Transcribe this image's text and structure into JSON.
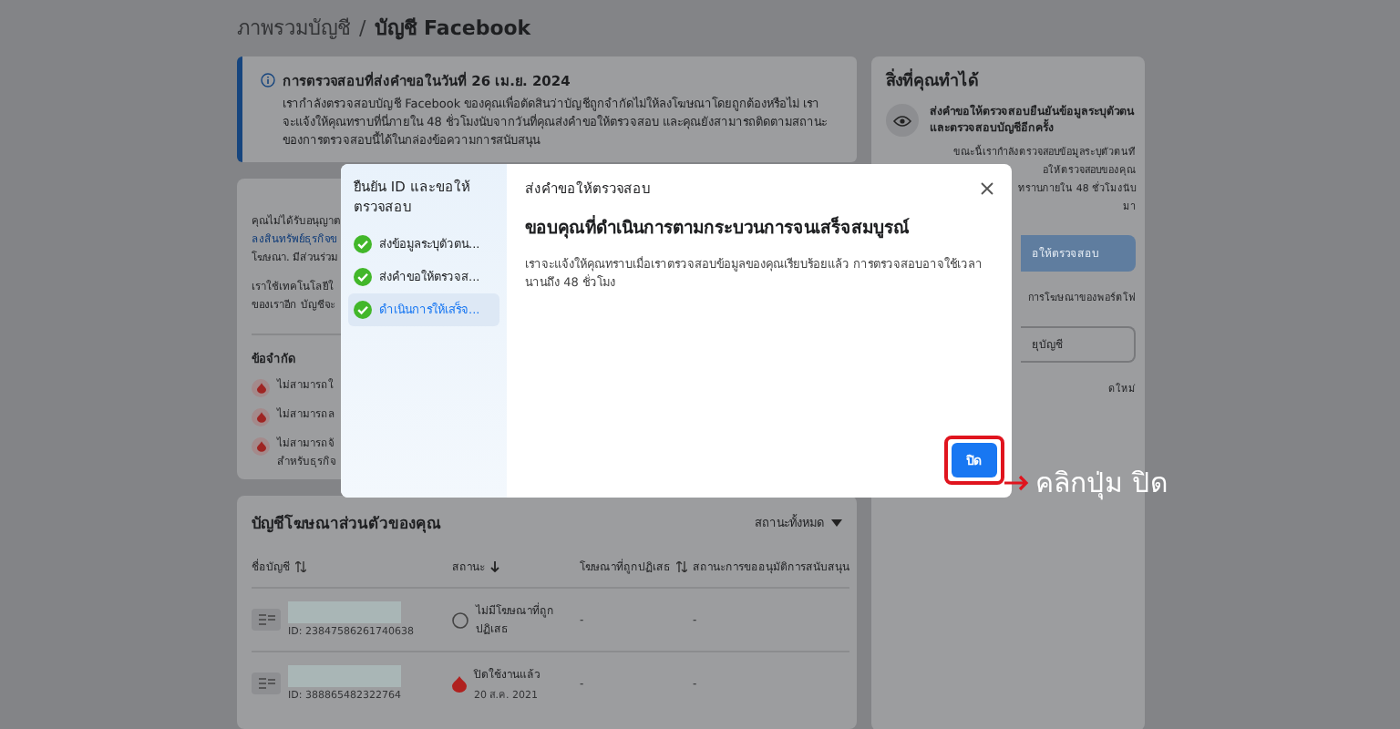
{
  "breadcrumb": {
    "parent": "ภาพรวมบัญชี",
    "separator": "/",
    "current": "บัญชี Facebook"
  },
  "notice": {
    "title": "การตรวจสอบที่ส่งคำขอในวันที่ 26 เม.ย. 2024",
    "body": "เรากำลังตรวจสอบบัญชี Facebook ของคุณเพื่อตัดสินว่าบัญชีถูกจำกัดไม่ให้ลงโฆษณาโดยถูกต้องหรือไม่ เราจะแจ้งให้คุณทราบที่นี่ภายใน 48 ชั่วโมงนับจากวันที่คุณส่งคำขอให้ตรวจสอบ และคุณยังสามารถติดตามสถานะของการตรวจสอบนี้ได้ในกล่องข้อความการสนับสนุน"
  },
  "restriction_card": {
    "paragraphs": [
      [
        {
          "kind": "text",
          "text": "คุณไม่ได้รับอนุญาต"
        },
        {
          "kind": "link",
          "text": "ลงสินทรัพย์ธุรกิจข"
        },
        {
          "kind": "text",
          "text": "โฆษณา. มีส่วนร่วม"
        }
      ],
      [
        {
          "kind": "text",
          "text": "เราใช้เทคโนโลยีใ"
        },
        {
          "kind": "text",
          "text": "ของเราอีก บัญชีจะ"
        }
      ]
    ],
    "limits_title": "ข้อจำกัด",
    "limits": [
      {
        "lines": [
          "ไม่สามารถใ"
        ]
      },
      {
        "lines": [
          "ไม่สามารถล"
        ]
      },
      {
        "lines": [
          "ไม่สามารถจั",
          "สำหรับธุรกิจ"
        ]
      }
    ]
  },
  "ad_accounts": {
    "title": "บัญชีโฆษณาส่วนตัวของคุณ",
    "filter": "สถานะทั้งหมด",
    "columns": [
      {
        "label": "ชื่อบัญชี",
        "kind": "sortable"
      },
      {
        "label": "สถานะ",
        "kind": "sorted"
      },
      {
        "label": "โฆษณาที่ถูกปฏิเสธ",
        "kind": "sortable"
      },
      {
        "label": "สถานะการขออนุมัติการสนับสนุน",
        "kind": "plain"
      }
    ],
    "rows": [
      {
        "id": "ID: 23847586261740638",
        "status": {
          "kind": "none",
          "lines": [
            "ไม่มีโฆษณาที่ถูก",
            "ปฏิเสธ"
          ]
        },
        "rejected": "-",
        "support": "-"
      },
      {
        "id": "ID: 388865482322764",
        "status": {
          "kind": "disabled",
          "lines": [
            "ปิดใช้งานแล้ว"
          ],
          "date": "20 ส.ค. 2021"
        },
        "rejected": "-",
        "support": "-"
      }
    ]
  },
  "actions_card": {
    "title": "สิ่งที่คุณทำได้",
    "item_title": "ส่งคำขอให้ตรวจสอบยืนยันข้อมูลระบุตัวตนและตรวจสอบบัญชีอีกครั้ง",
    "item_lines": [
      "ขณะนี้เรากำลังตรวจสอบข้อมูลระบุตัวตนที",
      "อให้ตรวจสอบของคุณ",
      "ทราบภายใน 48 ชั่วโมงนับ",
      "มา"
    ],
    "disabled_button": "อให้ตรวจสอบ",
    "section_line": "การโฆษณาของพอร์ตโฟ",
    "field_button": "ยุบัญชี",
    "footer_line": "ดใหม่"
  },
  "modal": {
    "sidebar_title": "ยืนยัน ID และขอให้ตรวจสอบ",
    "steps": [
      {
        "label": "ส่งข้อมูลระบุตัวตน...",
        "done": true,
        "selected": false
      },
      {
        "label": "ส่งคำขอให้ตรวจส...",
        "done": true,
        "selected": false
      },
      {
        "label": "ดำเนินการให้เสร็จ...",
        "done": true,
        "selected": true
      }
    ],
    "header": "ส่งคำขอให้ตรวจสอบ",
    "heading": "ขอบคุณที่ดำเนินการตามกระบวนการจนเสร็จสมบูรณ์",
    "body": "เราจะแจ้งให้คุณทราบเมื่อเราตรวจสอบข้อมูลของคุณเรียบร้อยแล้ว การตรวจสอบอาจใช้เวลานานถึง 48 ชั่วโมง",
    "button": {
      "label": "ปิด",
      "highlighted": true
    }
  },
  "annotation": {
    "text": "คลิกปุ่ม ปิด"
  }
}
